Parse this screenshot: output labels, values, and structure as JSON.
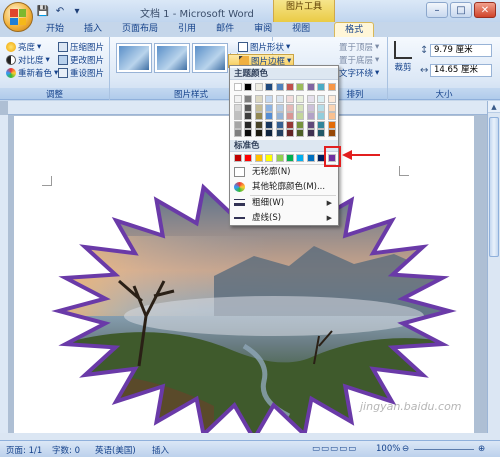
{
  "window": {
    "title": "文档 1 - Microsoft Word",
    "context_tool": "图片工具",
    "controls": [
      "–",
      "□",
      "✕"
    ]
  },
  "tabs": [
    "开始",
    "插入",
    "页面布局",
    "引用",
    "邮件",
    "审阅",
    "视图",
    "格式"
  ],
  "ribbon": {
    "adjust": {
      "label": "调整",
      "brightness": "亮度",
      "contrast": "对比度",
      "recolor": "重新着色",
      "compress": "压缩图片",
      "change": "更改图片",
      "reset": "重设图片"
    },
    "styles": {
      "label": "图片样式",
      "shape": "图片形状",
      "border": "图片边框"
    },
    "arrange": {
      "label": "排列",
      "front": "置于顶层",
      "back": "置于底层",
      "wrap": "文字环绕"
    },
    "size": {
      "label": "大小",
      "crop": "裁剪",
      "height": "9.79 厘米",
      "width": "14.65 厘米"
    }
  },
  "dropdown": {
    "theme_colors_header": "主题颜色",
    "standard_colors_header": "标准色",
    "no_outline": "无轮廓(N)",
    "more_colors": "其他轮廓颜色(M)...",
    "weight": "粗细(W)",
    "dashes": "虚线(S)",
    "theme_top_row": [
      "#ffffff",
      "#000000",
      "#eeece1",
      "#1f497d",
      "#4f81bd",
      "#c0504d",
      "#9bbb59",
      "#8064a2",
      "#4bacc6",
      "#f79646"
    ],
    "theme_shades": [
      [
        "#f2f2f2",
        "#7f7f7f",
        "#ddd9c3",
        "#c6d9f0",
        "#dbe5f1",
        "#f2dcdb",
        "#ebf1dd",
        "#e5e0ec",
        "#dbeef3",
        "#fdeada"
      ],
      [
        "#d8d8d8",
        "#595959",
        "#c4bd97",
        "#8db3e2",
        "#b8cce4",
        "#e5b9b7",
        "#d7e3bc",
        "#ccc1d9",
        "#b7dde8",
        "#fbd5b5"
      ],
      [
        "#bfbfbf",
        "#3f3f3f",
        "#938953",
        "#548dd4",
        "#95b3d7",
        "#d99694",
        "#c3d69b",
        "#b2a2c7",
        "#92cddc",
        "#fac08f"
      ],
      [
        "#a5a5a5",
        "#262626",
        "#494429",
        "#17365d",
        "#366092",
        "#953734",
        "#76923c",
        "#5f497a",
        "#31859b",
        "#e36c09"
      ],
      [
        "#7f7f7f",
        "#0c0c0c",
        "#1d1b10",
        "#0f243e",
        "#244061",
        "#632423",
        "#4f6128",
        "#3f3151",
        "#205867",
        "#974806"
      ]
    ],
    "standard": [
      "#c00000",
      "#ff0000",
      "#ffc000",
      "#ffff00",
      "#92d050",
      "#00b050",
      "#00b0f0",
      "#0070c0",
      "#002060",
      "#7030a0"
    ]
  },
  "status": {
    "page": "页面: 1/1",
    "words": "字数: 0",
    "language": "英语(美国)",
    "mode": "插入",
    "zoom": "100%"
  },
  "watermark": "jingyan.baidu.com"
}
